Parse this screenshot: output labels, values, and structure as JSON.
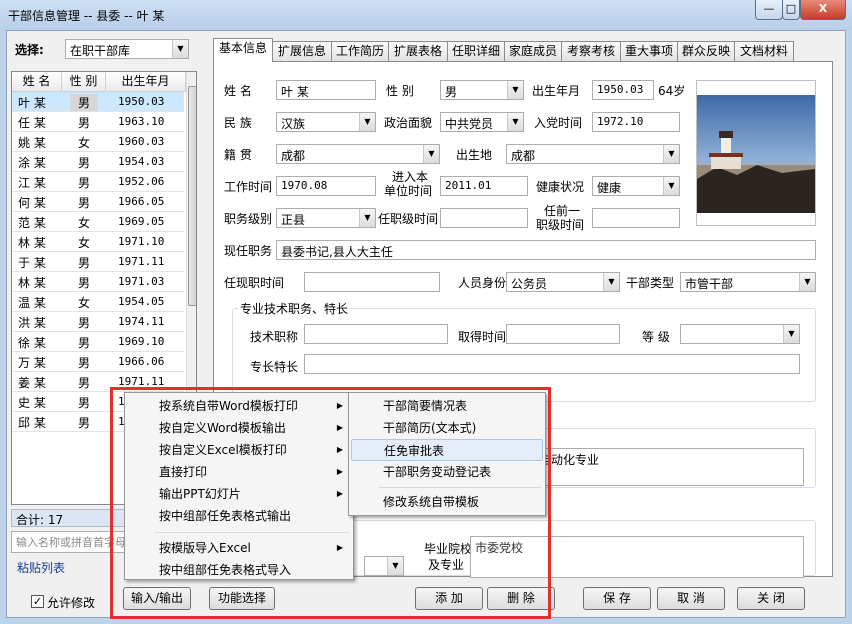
{
  "window": {
    "title": "干部信息管理 -- 县委 -- 叶 某",
    "btn_min": "—",
    "btn_max": "□",
    "btn_close": "X"
  },
  "left": {
    "select_label": "选择:",
    "select_value": "在职干部库",
    "columns": [
      "姓 名",
      "性 别",
      "出生年月"
    ],
    "rows": [
      {
        "name": "叶 某",
        "gender": "男",
        "birth": "1950.03"
      },
      {
        "name": "任 某",
        "gender": "男",
        "birth": "1963.10"
      },
      {
        "name": "姚 某",
        "gender": "女",
        "birth": "1960.03"
      },
      {
        "name": "涂 某",
        "gender": "男",
        "birth": "1954.03"
      },
      {
        "name": "江 某",
        "gender": "男",
        "birth": "1952.06"
      },
      {
        "name": "何 某",
        "gender": "男",
        "birth": "1966.05"
      },
      {
        "name": "范 某",
        "gender": "女",
        "birth": "1969.05"
      },
      {
        "name": "林 某",
        "gender": "女",
        "birth": "1971.10"
      },
      {
        "name": "于 某",
        "gender": "男",
        "birth": "1971.11"
      },
      {
        "name": "林 某",
        "gender": "男",
        "birth": "1971.03"
      },
      {
        "name": "温 某",
        "gender": "女",
        "birth": "1954.05"
      },
      {
        "name": "洪 某",
        "gender": "男",
        "birth": "1974.11"
      },
      {
        "name": "徐 某",
        "gender": "男",
        "birth": "1969.10"
      },
      {
        "name": "万 某",
        "gender": "男",
        "birth": "1966.06"
      },
      {
        "name": "姜 某",
        "gender": "男",
        "birth": "1971.11"
      },
      {
        "name": "史 某",
        "gender": "男",
        "birth": "1"
      },
      {
        "name": "邱 某",
        "gender": "男",
        "birth": "1"
      }
    ],
    "total": "合计: 17",
    "search_placeholder": "输入名称或拼音首字母",
    "paste_link": "粘贴列表",
    "allow_edit": "允许修改"
  },
  "tabs": [
    "基本信息",
    "扩展信息",
    "工作简历",
    "扩展表格",
    "任职详细",
    "家庭成员",
    "考察考核",
    "重大事项",
    "群众反映",
    "文档材料"
  ],
  "form": {
    "name_label": "姓 名",
    "name": "叶 某",
    "gender_label": "性 别",
    "gender": "男",
    "birth_label": "出生年月",
    "birth": "1950.03",
    "age": "64岁",
    "ethnic_label": "民 族",
    "ethnic": "汉族",
    "party_label": "政治面貌",
    "party": "中共党员",
    "join_label": "入党时间",
    "join": "1972.10",
    "native_label": "籍 贯",
    "native": "成都",
    "birthplace_label": "出生地",
    "birthplace": "成都",
    "work_label": "工作时间",
    "work": "1970.08",
    "enter_label_1": "进入本",
    "enter_label_2": "单位时间",
    "enter": "2011.01",
    "health_label": "健康状况",
    "health": "健康",
    "rank_label": "职务级别",
    "rank": "正县",
    "rank_time_label": "任职级时间",
    "rank_time": "",
    "prev_label_1": "任前一",
    "prev_label_2": "职级时间",
    "prev": "",
    "post_label": "现任职务",
    "post": "县委书记,县人大主任",
    "post_time_label": "任现职时间",
    "post_time": "",
    "identity_label": "人员身份",
    "identity": "公务员",
    "cadre_type_label": "干部类型",
    "cadre_type": "市管干部",
    "tech_group": "专业技术职务、特长",
    "tech_title_label": "技术职称",
    "tech_title": "",
    "obtain_label": "取得时间",
    "obtain": "",
    "level_label": "等 级",
    "level": "",
    "specialty_label": "专长特长",
    "specialty": "",
    "major_partial": "自动化专业",
    "school_label_1": "毕业院校",
    "school_label_2": "及专业",
    "school_partial": "市委党校"
  },
  "buttons": {
    "io": "输入/输出",
    "func": "功能选择",
    "add": "添 加",
    "delete": "删 除",
    "save": "保 存",
    "cancel": "取 消",
    "close": "关 闭"
  },
  "menu1": [
    {
      "label": "按系统自带Word模板打印",
      "sub": true
    },
    {
      "label": "按自定义Word模板输出",
      "sub": true
    },
    {
      "label": "按自定义Excel模板打印",
      "sub": true
    },
    {
      "label": "直接打印",
      "sub": true
    },
    {
      "label": "输出PPT幻灯片",
      "sub": true
    },
    {
      "label": "按中组部任免表格式输出",
      "sub": false
    },
    {
      "label": "按模版导入Excel",
      "sub": true
    },
    {
      "label": "按中组部任免表格式导入",
      "sub": false
    }
  ],
  "menu2": [
    {
      "label": "干部简要情况表"
    },
    {
      "label": "干部简历(文本式)"
    },
    {
      "label": "任免审批表"
    },
    {
      "label": "干部职务变动登记表"
    },
    {
      "label": "修改系统自带模板"
    }
  ],
  "colors": {
    "highlight_box": "#e03030",
    "selection": "#cce8ff",
    "titlebar": "#b7cfe8"
  }
}
